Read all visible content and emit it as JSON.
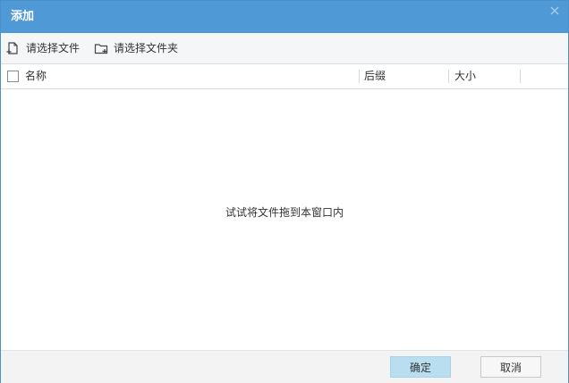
{
  "window": {
    "title": "添加",
    "close_icon": "close-icon"
  },
  "toolbar": {
    "select_file_label": "请选择文件",
    "select_folder_label": "请选择文件夹",
    "select_file_icon": "file-add-icon",
    "select_folder_icon": "folder-add-icon"
  },
  "table": {
    "columns": [
      "名称",
      "后缀",
      "大小"
    ],
    "rows": []
  },
  "empty_hint": "试试将文件拖到本窗口内",
  "footer": {
    "ok_label": "确定",
    "cancel_label": "取消"
  },
  "colors": {
    "titlebar": "#4f9ad6",
    "ok_button": "#b8def0"
  }
}
